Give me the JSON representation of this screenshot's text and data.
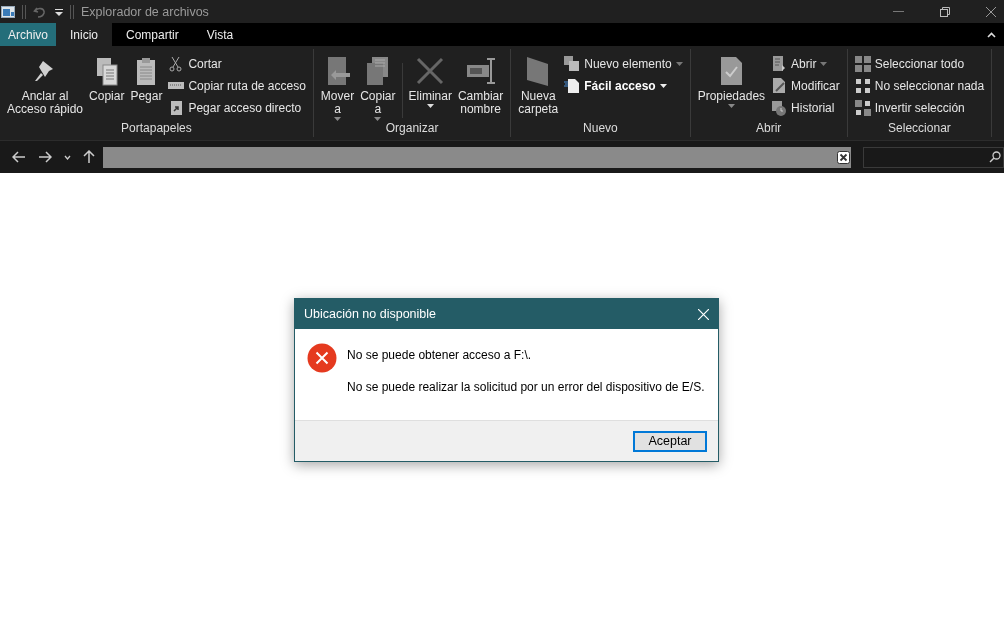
{
  "window": {
    "title": "Explorador de archivos"
  },
  "tabs": [
    {
      "label": "Archivo",
      "kind": "file",
      "selected": false
    },
    {
      "label": "Inicio",
      "kind": "tab",
      "selected": true
    },
    {
      "label": "Compartir",
      "kind": "tab",
      "selected": false
    },
    {
      "label": "Vista",
      "kind": "tab",
      "selected": false
    }
  ],
  "ribbon": {
    "groups": [
      {
        "label": "Portapapeles",
        "items": [
          {
            "kind": "large",
            "label": "Anclar al\nAcceso rápido",
            "dropdown": false
          },
          {
            "kind": "large",
            "label": "Copiar",
            "dropdown": false
          },
          {
            "kind": "large",
            "label": "Pegar",
            "dropdown": false
          },
          {
            "kind": "small",
            "entries": [
              {
                "label": "Cortar",
                "dropdown": false
              },
              {
                "label": "Copiar ruta de acceso",
                "dropdown": false
              },
              {
                "label": "Pegar acceso directo",
                "dropdown": false
              }
            ]
          }
        ]
      },
      {
        "label": "Organizar",
        "items": [
          {
            "kind": "large",
            "label": "Mover\na",
            "dropdown": true
          },
          {
            "kind": "large",
            "label": "Copiar\na",
            "dropdown": true
          },
          {
            "kind": "separator"
          },
          {
            "kind": "large",
            "label": "Eliminar",
            "dropdown": true
          },
          {
            "kind": "large",
            "label": "Cambiar\nnombre",
            "dropdown": false
          }
        ]
      },
      {
        "label": "Nuevo",
        "items": [
          {
            "kind": "large",
            "label": "Nueva\ncarpeta",
            "dropdown": false
          },
          {
            "kind": "small",
            "entries": [
              {
                "label": "Nuevo elemento",
                "dropdown": true
              },
              {
                "label": "Fácil acceso",
                "dropdown": true
              }
            ]
          }
        ]
      },
      {
        "label": "Abrir",
        "items": [
          {
            "kind": "large",
            "label": "Propiedades",
            "dropdown": true
          },
          {
            "kind": "small",
            "entries": [
              {
                "label": "Abrir",
                "dropdown": true
              },
              {
                "label": "Modificar",
                "dropdown": false
              },
              {
                "label": "Historial",
                "dropdown": false
              }
            ]
          }
        ]
      },
      {
        "label": "Seleccionar",
        "items": [
          {
            "kind": "small",
            "entries": [
              {
                "label": "Seleccionar todo",
                "dropdown": false
              },
              {
                "label": "No seleccionar nada",
                "dropdown": false
              },
              {
                "label": "Invertir selección",
                "dropdown": false
              }
            ]
          }
        ]
      }
    ]
  },
  "dialog": {
    "title": "Ubicación no disponible",
    "message": "No se puede obtener acceso a F:\\.",
    "detail": "No se puede realizar la solicitud por un error del dispositivo de E/S.",
    "button": "Aceptar"
  }
}
